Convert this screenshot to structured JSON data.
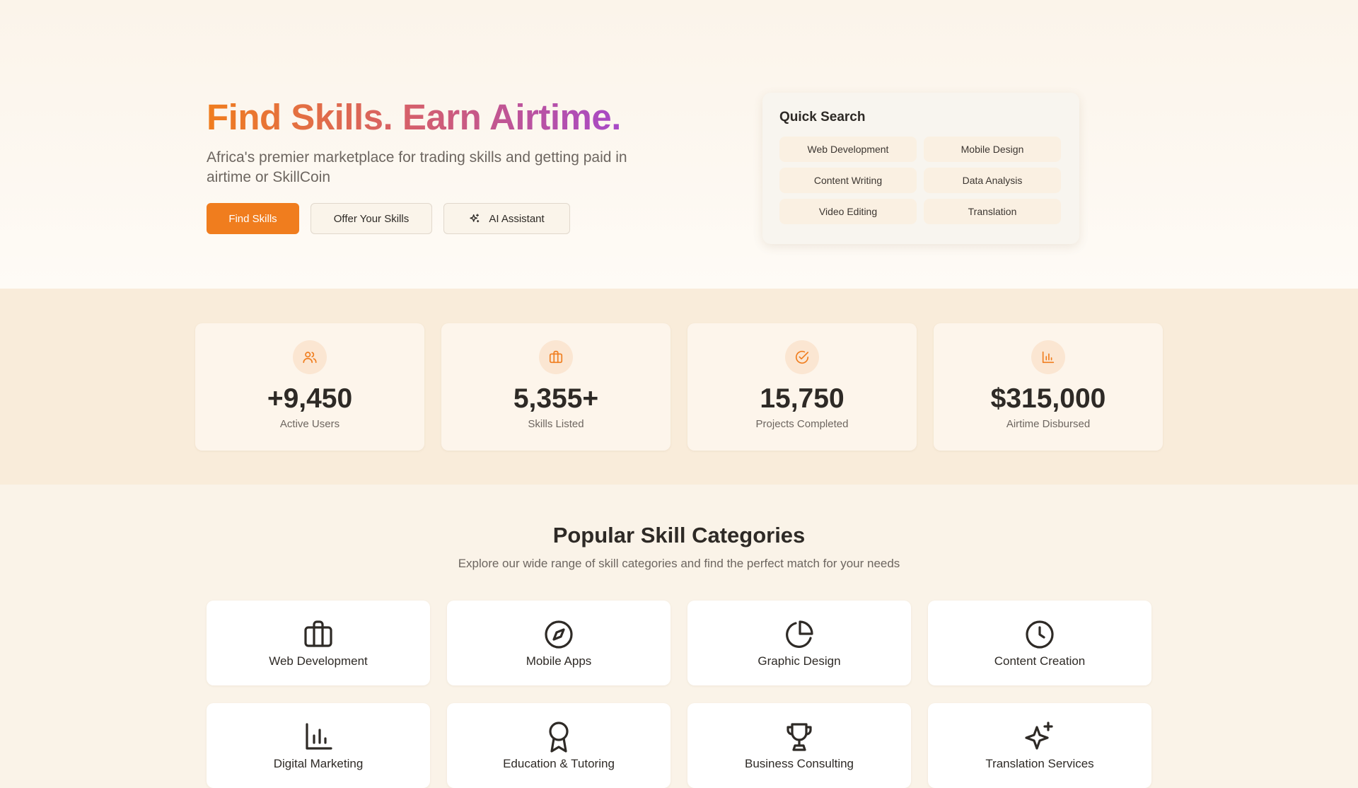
{
  "hero": {
    "title": "Find Skills. Earn Airtime.",
    "subtitle": "Africa's premier marketplace for trading skills and getting paid in airtime or SkillCoin",
    "buttons": {
      "find": "Find Skills",
      "offer": "Offer Your Skills",
      "ai": "AI Assistant"
    }
  },
  "quick_search": {
    "title": "Quick Search",
    "chips": [
      "Web Development",
      "Mobile Design",
      "Content Writing",
      "Data Analysis",
      "Video Editing",
      "Translation"
    ]
  },
  "stats": [
    {
      "value": "+9,450",
      "label": "Active Users",
      "icon": "users-icon"
    },
    {
      "value": "5,355+",
      "label": "Skills Listed",
      "icon": "briefcase-icon"
    },
    {
      "value": "15,750",
      "label": "Projects Completed",
      "icon": "check-circle-icon"
    },
    {
      "value": "$315,000",
      "label": "Airtime Disbursed",
      "icon": "bar-chart-icon"
    }
  ],
  "categories": {
    "title": "Popular Skill Categories",
    "subtitle": "Explore our wide range of skill categories and find the perfect match for your needs",
    "items": [
      {
        "label": "Web Development",
        "icon": "briefcase-icon"
      },
      {
        "label": "Mobile Apps",
        "icon": "compass-icon"
      },
      {
        "label": "Graphic Design",
        "icon": "pie-chart-icon"
      },
      {
        "label": "Content Creation",
        "icon": "clock-icon"
      },
      {
        "label": "Digital Marketing",
        "icon": "bar-chart-icon"
      },
      {
        "label": "Education & Tutoring",
        "icon": "award-icon"
      },
      {
        "label": "Business Consulting",
        "icon": "trophy-icon"
      },
      {
        "label": "Translation Services",
        "icon": "sparkles-icon"
      }
    ]
  },
  "colors": {
    "accent": "#f07d1e",
    "gradient_end": "#9e45d9",
    "background": "#faf3e8"
  }
}
